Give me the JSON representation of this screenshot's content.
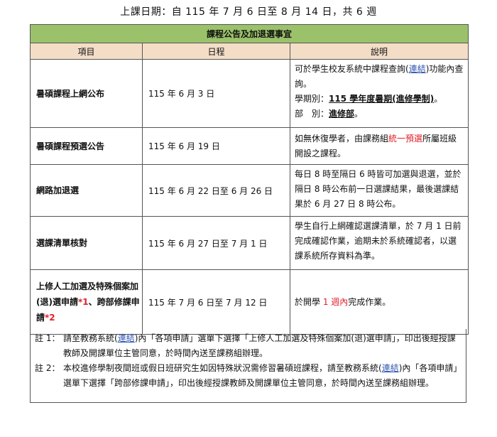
{
  "top_title": "上課日期：自 115 年 7 月 6 日至 8 月 14 日，共 6 週",
  "banner": "課程公告及加退選事宜",
  "headers": {
    "item": "項目",
    "date": "日程",
    "desc": "說明"
  },
  "rows": [
    {
      "item": "暑碩課程上網公布",
      "date": "115 年 6 月 3 日",
      "desc": {
        "l1_pre": "可於學生校友系統中課程查詢(",
        "l1_link": "連結",
        "l1_post": ")功能內查詢。",
        "l2_pre": "學期別：",
        "l2_val": "115 學年度暑期(進修學制)",
        "l2_post": "。",
        "l3_pre": "部　別：",
        "l3_val": "進修部",
        "l3_post": "。"
      }
    },
    {
      "item": "暑碩課程預選公告",
      "date": "115 年 6 月 19 日",
      "desc": {
        "pre": "如無休復學者，由課務組",
        "red": "統一預選",
        "post": "所屬班級開設之課程。"
      }
    },
    {
      "item": "網路加退選",
      "date": "115 年 6 月 22 日至 6 月 26 日",
      "desc": {
        "text": "每日 8 時至隔日 6 時皆可加選與退選，並於隔日 8 時公布前一日選課結果，最後選課結果於 6 月 27 日 8 時公布。"
      }
    },
    {
      "item": "選課清單核對",
      "date": "115 年 6 月 27 日至 7 月 1 日",
      "desc": {
        "text": "學生自行上網確認選課清單，於 7 月 1 日前完成確認作業，逾期未於系統確認者，以選課系統所存資料為準。"
      }
    },
    {
      "item_a": "上修人工加選及特殊個案加(退)選申請",
      "item_sup1": "*1",
      "item_b": "、跨部修課申請",
      "item_sup2": "*2",
      "date": "115 年 7 月 6 日至 7 月 12 日",
      "desc": {
        "pre": "於開學 ",
        "red": "1 週內",
        "post": "完成作業。"
      }
    }
  ],
  "notes": [
    {
      "label": "註 1：",
      "pre": "請至教務系統(",
      "link": "連結",
      "post": ")內「各項申請」選單下選擇「上修人工加選及特殊個案加(退)選申請」，印出後經授課教師及開課單位主管同意，於時間內送至課務組辦理。"
    },
    {
      "label": "註 2：",
      "pre": "本校進修學制夜間班或假日班研究生如因特殊狀況需修習暑碩班課程，請至教務系統(",
      "link": "連結",
      "post": ")內「各項申請」選單下選擇「跨部修課申請」，印出後經授課教師及開課單位主管同意，於時間內送至課務組辦理。"
    }
  ]
}
